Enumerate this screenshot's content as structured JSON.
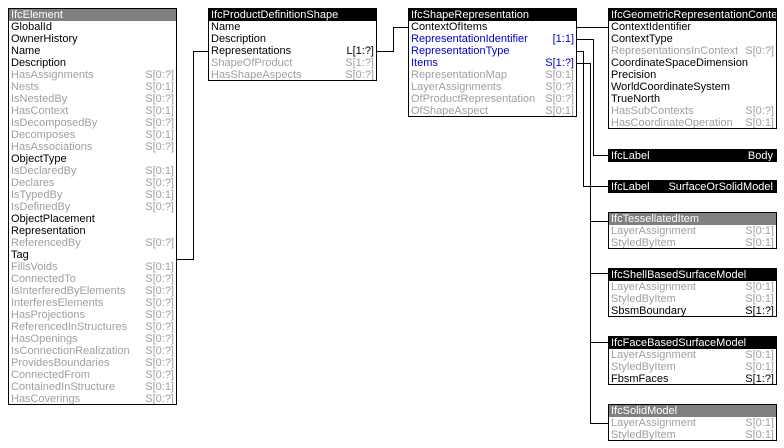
{
  "boxes": {
    "element": {
      "title": "IfcElement",
      "header": "gray",
      "attrs": [
        {
          "name": "GlobalId",
          "card": "",
          "style": ""
        },
        {
          "name": "OwnerHistory",
          "card": "",
          "style": ""
        },
        {
          "name": "Name",
          "card": "",
          "style": ""
        },
        {
          "name": "Description",
          "card": "",
          "style": ""
        },
        {
          "name": "HasAssignments",
          "card": "S[0:?]",
          "style": "gray"
        },
        {
          "name": "Nests",
          "card": "S[0:1]",
          "style": "gray"
        },
        {
          "name": "IsNestedBy",
          "card": "S[0:?]",
          "style": "gray"
        },
        {
          "name": "HasContext",
          "card": "S[0:1]",
          "style": "gray"
        },
        {
          "name": "IsDecomposedBy",
          "card": "S[0:?]",
          "style": "gray"
        },
        {
          "name": "Decomposes",
          "card": "S[0:1]",
          "style": "gray"
        },
        {
          "name": "HasAssociations",
          "card": "S[0:?]",
          "style": "gray"
        },
        {
          "name": "ObjectType",
          "card": "",
          "style": ""
        },
        {
          "name": "IsDeclaredBy",
          "card": "S[0:1]",
          "style": "gray"
        },
        {
          "name": "Declares",
          "card": "S[0:?]",
          "style": "gray"
        },
        {
          "name": "IsTypedBy",
          "card": "S[0:1]",
          "style": "gray"
        },
        {
          "name": "IsDefinedBy",
          "card": "S[0:?]",
          "style": "gray"
        },
        {
          "name": "ObjectPlacement",
          "card": "",
          "style": ""
        },
        {
          "name": "Representation",
          "card": "",
          "style": ""
        },
        {
          "name": "ReferencedBy",
          "card": "S[0:?]",
          "style": "gray"
        },
        {
          "name": "Tag",
          "card": "",
          "style": ""
        },
        {
          "name": "FillsVoids",
          "card": "S[0:1]",
          "style": "gray"
        },
        {
          "name": "ConnectedTo",
          "card": "S[0:?]",
          "style": "gray"
        },
        {
          "name": "IsInterferedByElements",
          "card": "S[0:?]",
          "style": "gray"
        },
        {
          "name": "InterferesElements",
          "card": "S[0:?]",
          "style": "gray"
        },
        {
          "name": "HasProjections",
          "card": "S[0:?]",
          "style": "gray"
        },
        {
          "name": "ReferencedInStructures",
          "card": "S[0:?]",
          "style": "gray"
        },
        {
          "name": "HasOpenings",
          "card": "S[0:?]",
          "style": "gray"
        },
        {
          "name": "IsConnectionRealization",
          "card": "S[0:?]",
          "style": "gray"
        },
        {
          "name": "ProvidesBoundaries",
          "card": "S[0:?]",
          "style": "gray"
        },
        {
          "name": "ConnectedFrom",
          "card": "S[0:?]",
          "style": "gray"
        },
        {
          "name": "ContainedInStructure",
          "card": "S[0:1]",
          "style": "gray"
        },
        {
          "name": "HasCoverings",
          "card": "S[0:?]",
          "style": "gray"
        }
      ]
    },
    "pds": {
      "title": "IfcProductDefinitionShape",
      "header": "black",
      "attrs": [
        {
          "name": "Name",
          "card": "",
          "style": ""
        },
        {
          "name": "Description",
          "card": "",
          "style": ""
        },
        {
          "name": "Representations",
          "card": "L[1:?]",
          "style": ""
        },
        {
          "name": "ShapeOfProduct",
          "card": "S[1:?]",
          "style": "gray"
        },
        {
          "name": "HasShapeAspects",
          "card": "S[0:?]",
          "style": "gray"
        }
      ]
    },
    "shaperep": {
      "title": "IfcShapeRepresentation",
      "header": "black",
      "attrs": [
        {
          "name": "ContextOfItems",
          "card": "",
          "style": ""
        },
        {
          "name": "RepresentationIdentifier",
          "card": "[1:1]",
          "style": "blue"
        },
        {
          "name": "RepresentationType",
          "card": "",
          "style": "blue"
        },
        {
          "name": "Items",
          "card": "S[1:?]",
          "style": "blue"
        },
        {
          "name": "RepresentationMap",
          "card": "S[0:1]",
          "style": "gray"
        },
        {
          "name": "LayerAssignments",
          "card": "S[0:?]",
          "style": "gray"
        },
        {
          "name": "OfProductRepresentation",
          "card": "S[0:?]",
          "style": "gray"
        },
        {
          "name": "OfShapeAspect",
          "card": "S[0:1]",
          "style": "gray"
        }
      ]
    },
    "grc": {
      "title": "IfcGeometricRepresentationContext",
      "header": "black",
      "attrs": [
        {
          "name": "ContextIdentifier",
          "card": "",
          "style": ""
        },
        {
          "name": "ContextType",
          "card": "",
          "style": ""
        },
        {
          "name": "RepresentationsInContext",
          "card": "S[0:?]",
          "style": "gray"
        },
        {
          "name": "CoordinateSpaceDimension",
          "card": "",
          "style": ""
        },
        {
          "name": "Precision",
          "card": "",
          "style": ""
        },
        {
          "name": "WorldCoordinateSystem",
          "card": "",
          "style": ""
        },
        {
          "name": "TrueNorth",
          "card": "",
          "style": ""
        },
        {
          "name": "HasSubContexts",
          "card": "S[0:?]",
          "style": "gray"
        },
        {
          "name": "HasCoordinateOperation",
          "card": "S[0:1]",
          "style": "gray"
        }
      ]
    },
    "label_body": {
      "title": "IfcLabel",
      "header": "black",
      "value": "Body",
      "attrs": []
    },
    "label_surface": {
      "title": "IfcLabel",
      "header": "black",
      "value": "SurfaceOrSolidModel",
      "attrs": []
    },
    "tess": {
      "title": "IfcTessellatedItem",
      "header": "gray",
      "attrs": [
        {
          "name": "LayerAssignment",
          "card": "S[0:1]",
          "style": "gray"
        },
        {
          "name": "StyledByItem",
          "card": "S[0:1]",
          "style": "gray"
        }
      ]
    },
    "shell": {
      "title": "IfcShellBasedSurfaceModel",
      "header": "black",
      "attrs": [
        {
          "name": "LayerAssignment",
          "card": "S[0:1]",
          "style": "gray"
        },
        {
          "name": "StyledByItem",
          "card": "S[0:1]",
          "style": "gray"
        },
        {
          "name": "SbsmBoundary",
          "card": "S[1:?]",
          "style": "ul"
        }
      ]
    },
    "face": {
      "title": "IfcFaceBasedSurfaceModel",
      "header": "black",
      "attrs": [
        {
          "name": "LayerAssignment",
          "card": "S[0:1]",
          "style": "gray"
        },
        {
          "name": "StyledByItem",
          "card": "S[0:1]",
          "style": "gray"
        },
        {
          "name": "FbsmFaces",
          "card": "S[1:?]",
          "style": "ul"
        }
      ]
    },
    "solid": {
      "title": "IfcSolidModel",
      "header": "gray",
      "attrs": [
        {
          "name": "LayerAssignment",
          "card": "S[0:1]",
          "style": "gray"
        },
        {
          "name": "StyledByItem",
          "card": "S[0:1]",
          "style": "gray"
        }
      ]
    }
  }
}
